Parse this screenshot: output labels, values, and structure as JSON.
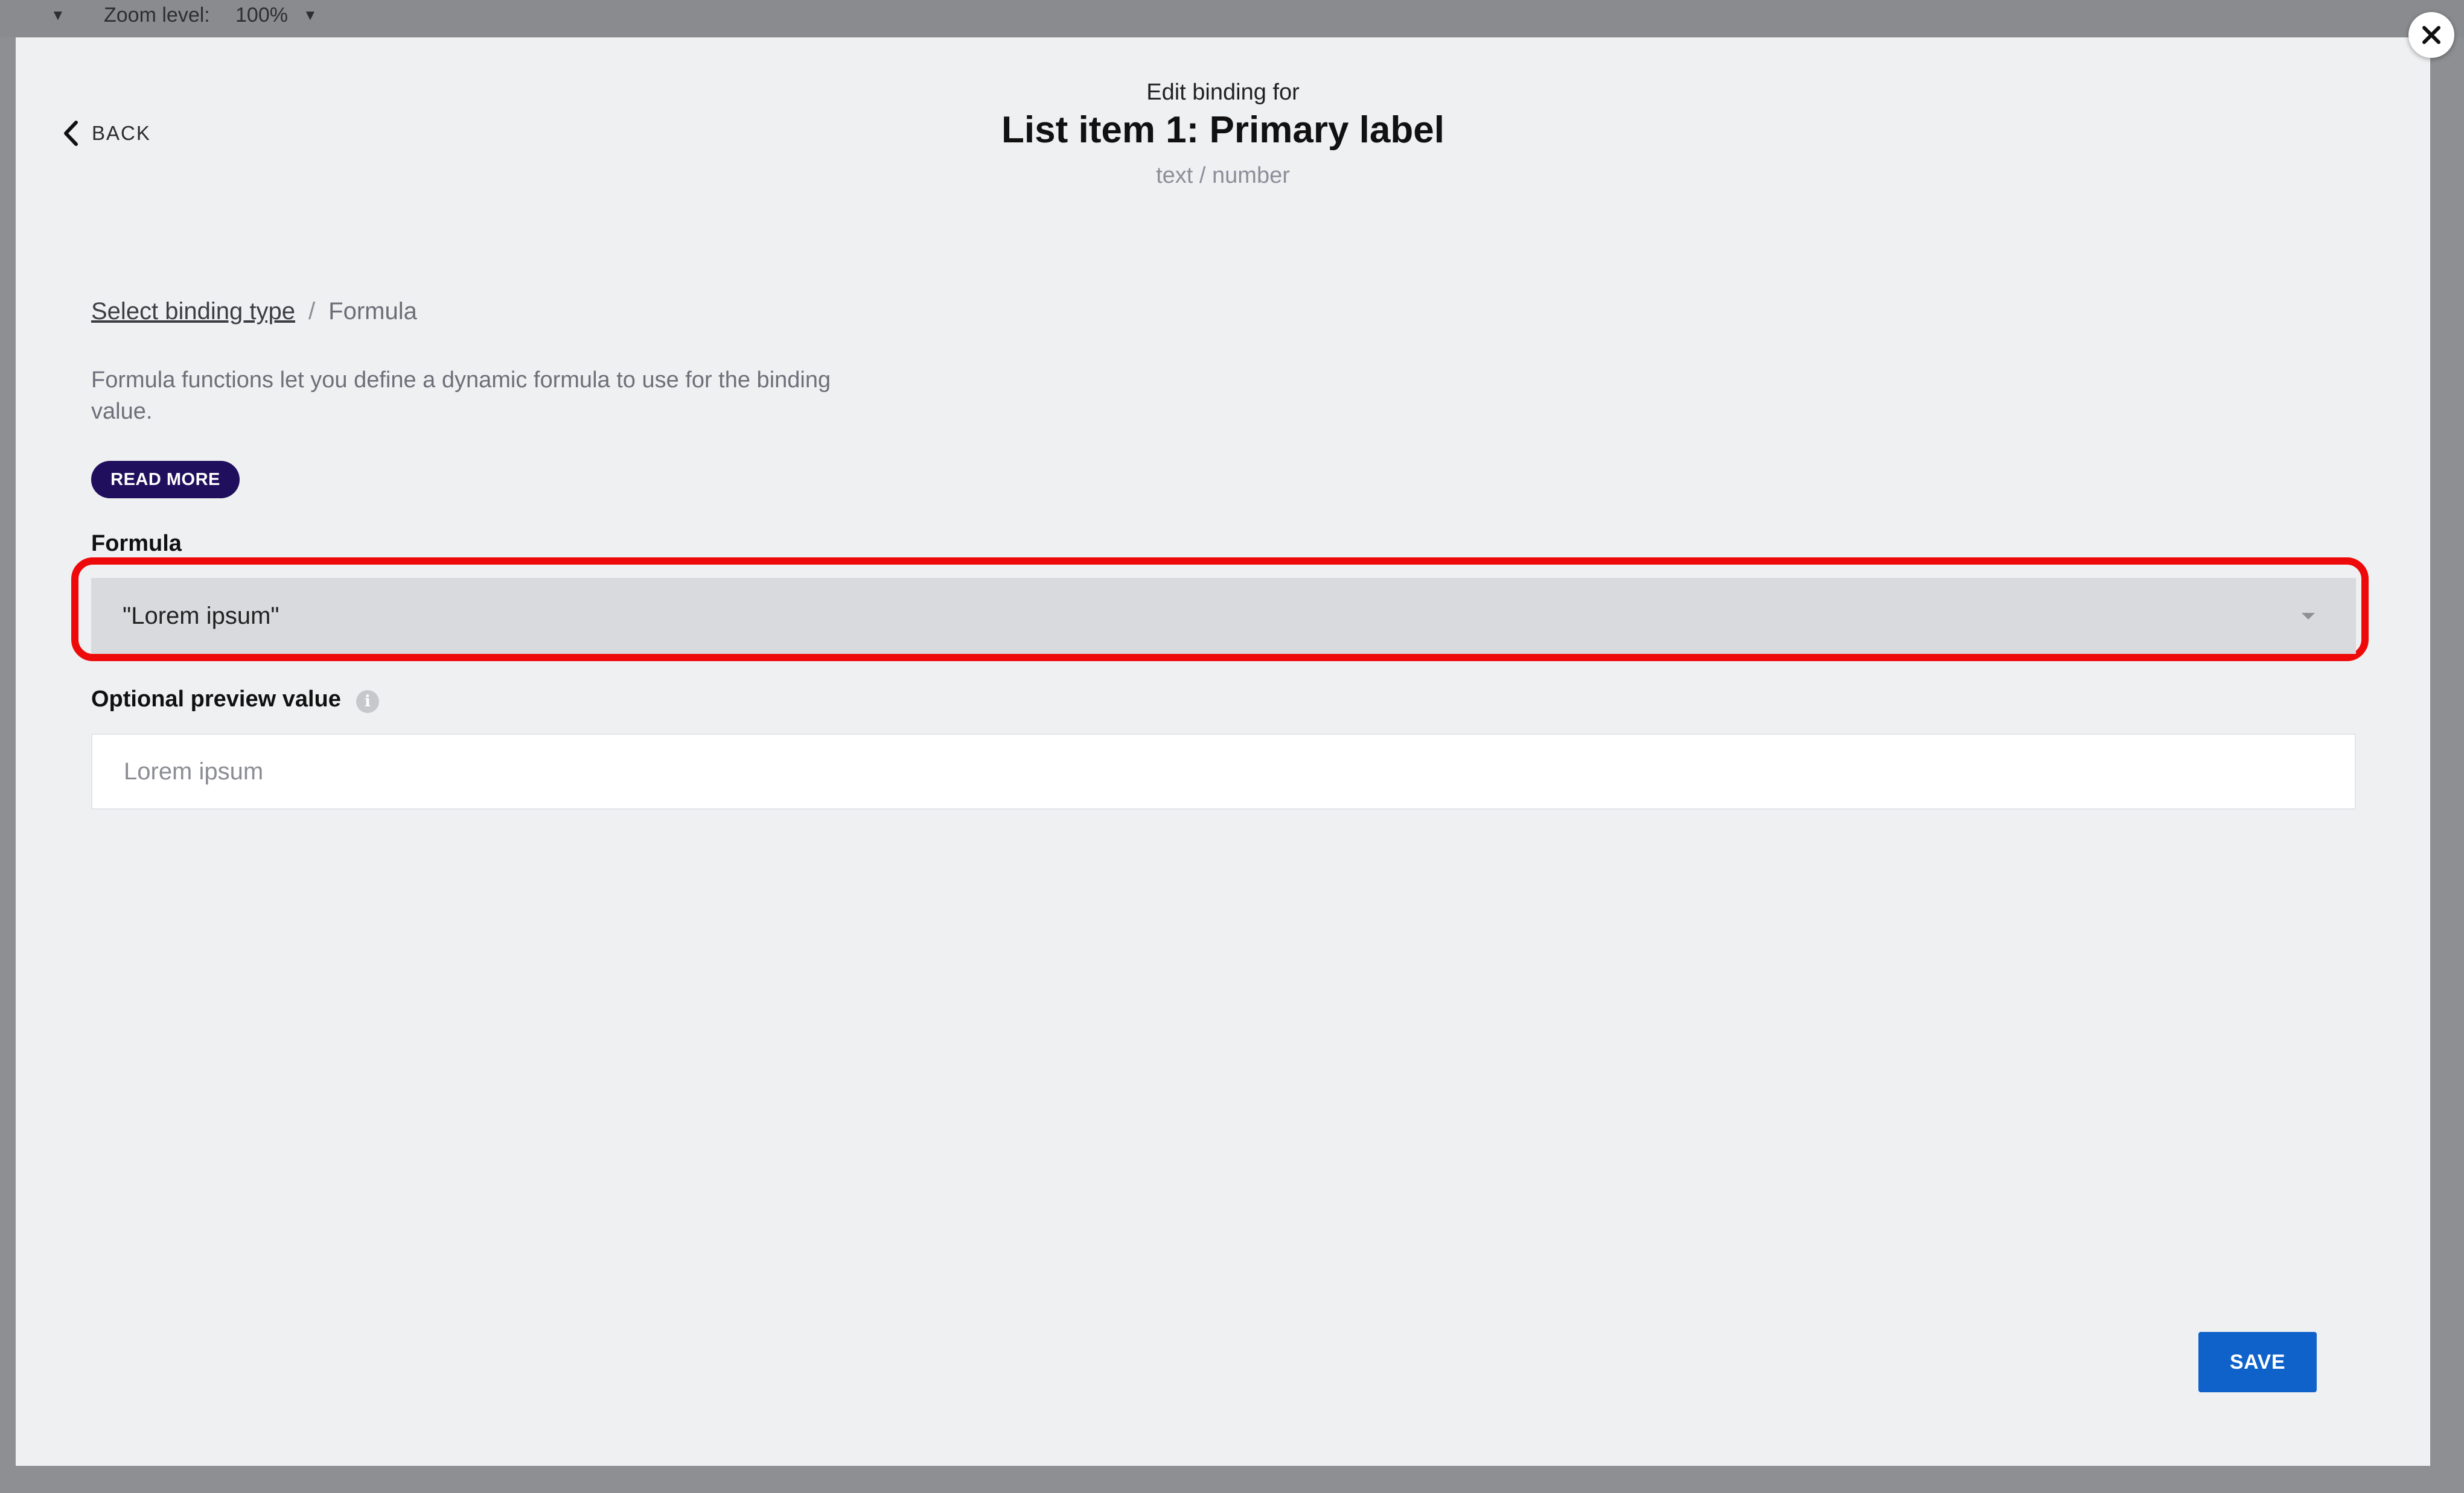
{
  "topbar": {
    "zoom_label": "Zoom level:",
    "zoom_value": "100%"
  },
  "modal": {
    "close_icon": "close-icon",
    "back_label": "BACK",
    "header": {
      "pre_title": "Edit binding for",
      "title": "List item 1: Primary label",
      "subtitle": "text / number"
    },
    "breadcrumb": {
      "link": "Select binding type",
      "separator": "/",
      "current": "Formula"
    },
    "description": "Formula functions let you define a dynamic formula to use for the binding value.",
    "read_more_label": "READ MORE",
    "formula": {
      "label": "Formula",
      "value": "\"Lorem ipsum\""
    },
    "preview": {
      "label": "Optional preview value",
      "placeholder": "Lorem ipsum",
      "info_icon": "info-icon"
    },
    "save_label": "SAVE"
  },
  "colors": {
    "highlight": "#ee0a0a",
    "read_more_bg": "#1f0f5c",
    "save_bg": "#0f62c9"
  }
}
